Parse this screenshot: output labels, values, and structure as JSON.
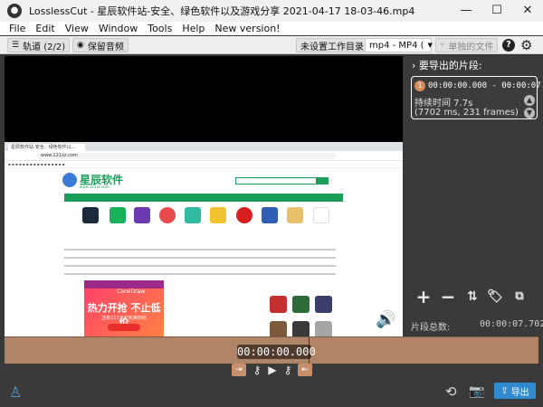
{
  "window": {
    "title": "LosslessCut - 星辰软件站-安全、绿色软件以及游戏分享 2021-04-17 18-03-46.mp4",
    "minimize": "—",
    "maximize": "☐",
    "close": "✕"
  },
  "menu": [
    "File",
    "Edit",
    "View",
    "Window",
    "Tools",
    "Help",
    "New version!"
  ],
  "toolbar": {
    "tracks_label": "轨道 (2/2)",
    "keep_audio_label": "保留音频",
    "workdir_label": "未设置工作目录",
    "format_label": "mp4 - MP4 (",
    "format_caret": "▼",
    "single_file_label": "单独的文件",
    "help": "?",
    "settings": "⚙"
  },
  "browser": {
    "tab_title": "星辰软件站-安全、绿色软件以...",
    "address": "www.121xz.com",
    "logo_text": "星辰软件",
    "logo_url": "www.121xz.com",
    "promo_brand": "CorelDraw",
    "promo_line1": "热力开抢 不止低价",
    "promo_line2": "还有111元红包等你抢"
  },
  "panel": {
    "title": "要导出的片段:",
    "segment": {
      "number": "1",
      "range": "00:00:00.000 - 00:00:07.702",
      "duration": "持续时间 7.7s",
      "detail": "(7702 ms, 231 frames)"
    },
    "total_label": "片段总数:",
    "total_value": "00:00:07.702"
  },
  "timeline": {
    "current_time": "00:00:00.000",
    "accent": "#b08567"
  },
  "controls": {
    "export_label": "导出"
  },
  "colors": {
    "export_button": "#2f8ad0",
    "segment_badge": "#d98b5a"
  }
}
